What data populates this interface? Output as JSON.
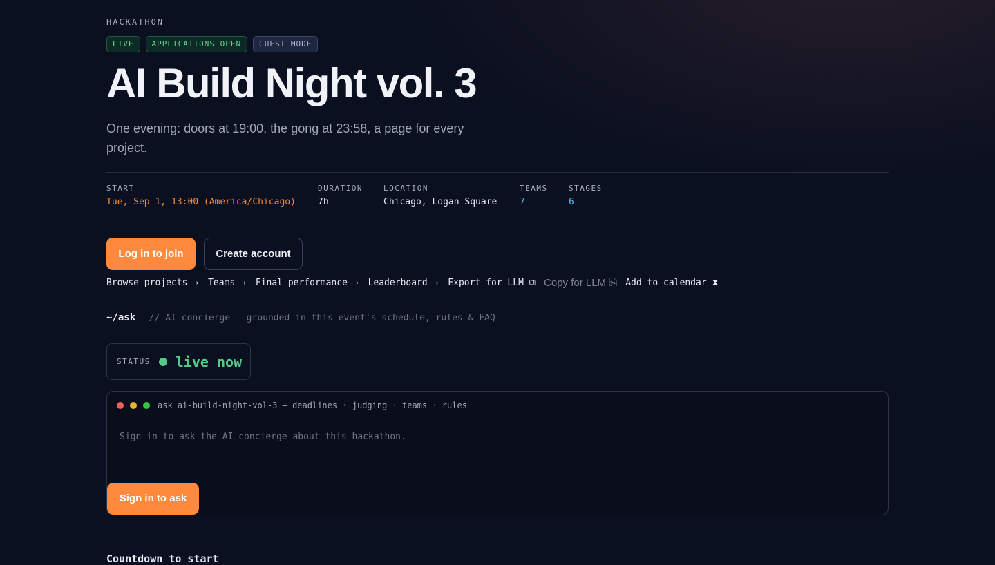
{
  "eyebrow": "HACKATHON",
  "badges": {
    "live": "LIVE",
    "applications": "APPLICATIONS OPEN",
    "guest": "GUEST MODE"
  },
  "title": "AI Build Night vol. 3",
  "subtitle": "One evening: doors at 19:00, the gong at 23:58, a page for every project.",
  "meta": {
    "start": {
      "label": "START",
      "value": "Tue, Sep 1, 13:00 (America/Chicago)"
    },
    "duration": {
      "label": "DURATION",
      "value": "7h"
    },
    "location": {
      "label": "LOCATION",
      "value": "Chicago, Logan Square"
    },
    "teams": {
      "label": "TEAMS",
      "value": "7"
    },
    "stages": {
      "label": "STAGES",
      "value": "6"
    }
  },
  "actions": {
    "login": "Log in to join",
    "create": "Create account"
  },
  "links": {
    "browse": "Browse projects →",
    "teams": "Teams →",
    "final": "Final performance →",
    "leaderboard": "Leaderboard →",
    "export": "Export for LLM ⧉",
    "copy": "Copy for LLM ⎘",
    "calendar": "Add to calendar ⧗"
  },
  "ask": {
    "command": "~/ask",
    "note": "// AI concierge — grounded in this event's schedule, rules & FAQ"
  },
  "status": {
    "label": "STATUS",
    "value": "live now"
  },
  "terminal": {
    "title": "ask ai-build-night-vol-3 — deadlines · judging · teams · rules",
    "placeholder": "Sign in to ask the AI concierge about this hackathon.",
    "button": "Sign in to ask"
  },
  "next_heading": "Countdown to start"
}
